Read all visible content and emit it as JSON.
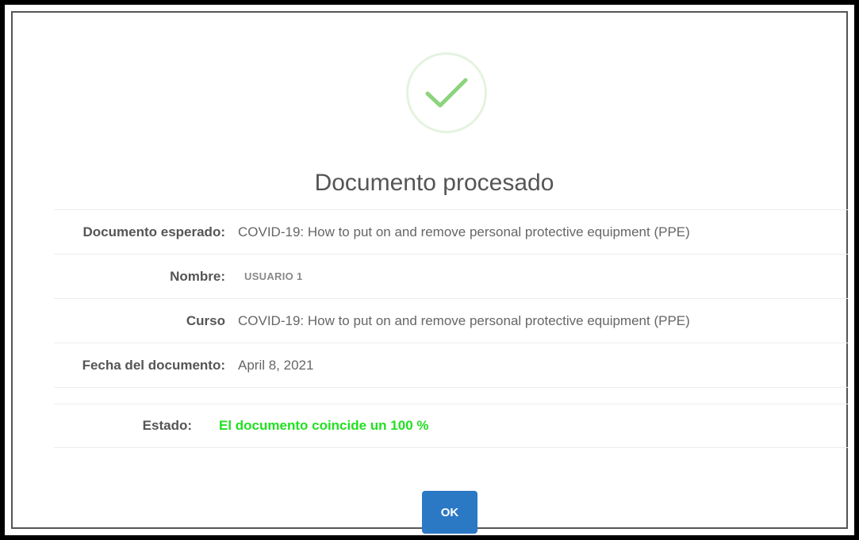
{
  "dialog": {
    "icon": "checkmark-success-icon",
    "title": "Documento procesado",
    "rows": [
      {
        "label": "Documento esperado:",
        "value": "COVID-19: How to put on and remove personal protective equipment (PPE)"
      },
      {
        "label": "Nombre:",
        "value": "USUARIO 1"
      },
      {
        "label": "Curso",
        "value": "COVID-19: How to put on and remove personal protective equipment (PPE)"
      },
      {
        "label": "Fecha del documento:",
        "value": "April 8, 2021"
      }
    ],
    "status": {
      "label": "Estado:",
      "value": "El documento coincide un 100 %"
    },
    "ok_label": "OK"
  },
  "colors": {
    "accent_button": "#2b78c5",
    "success_text": "#22e022",
    "check_green": "#8cd47e"
  }
}
